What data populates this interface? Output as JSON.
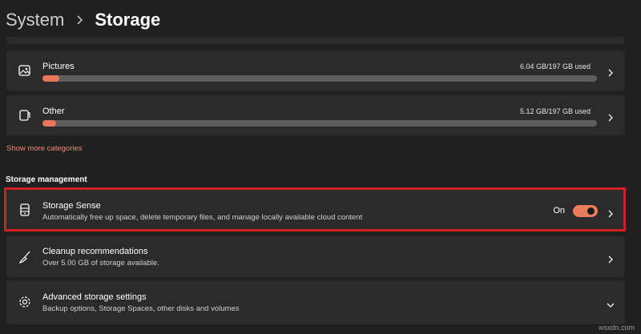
{
  "breadcrumb": {
    "parent": "System",
    "current": "Storage"
  },
  "categories": [
    {
      "name": "Pictures",
      "used": "6.04 GB/197 GB used",
      "fill_percent": 3
    },
    {
      "name": "Other",
      "used": "5.12 GB/197 GB used",
      "fill_percent": 2.5
    }
  ],
  "show_more": "Show more categories",
  "section_title": "Storage management",
  "storage_sense": {
    "title": "Storage Sense",
    "subtitle": "Automatically free up space, delete temporary files, and manage locally available cloud content",
    "toggle_label": "On",
    "toggle_on": true
  },
  "cleanup": {
    "title": "Cleanup recommendations",
    "subtitle": "Over 5.00 GB of storage available."
  },
  "advanced": {
    "title": "Advanced storage settings",
    "subtitle": "Backup options, Storage Spaces, other disks and volumes"
  },
  "watermark": "wsxdn.com",
  "colors": {
    "accent": "#e8775b",
    "highlight": "#d11f25",
    "background": "#202020",
    "card": "#2b2b2b"
  },
  "icons": {
    "pictures": "image-icon",
    "other": "document-icon",
    "storage_sense": "drive-icon",
    "cleanup": "broom-icon",
    "advanced": "gear-icon"
  }
}
